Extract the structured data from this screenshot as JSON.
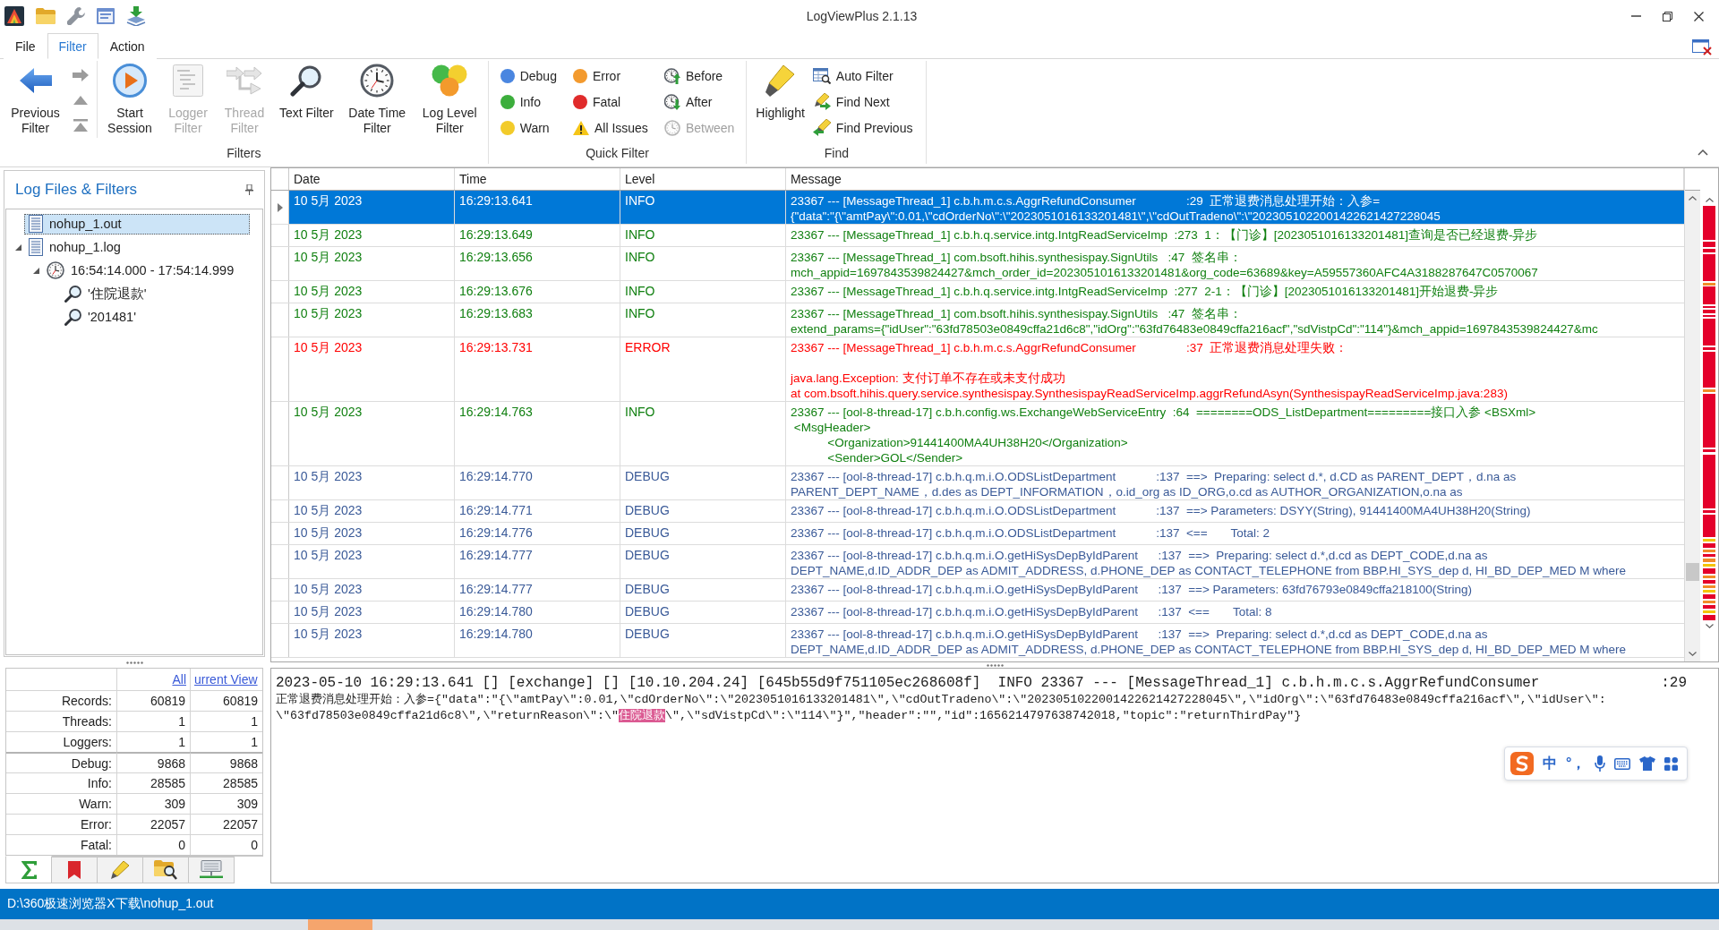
{
  "window": {
    "title": "LogViewPlus 2.1.13"
  },
  "menu_tabs": [
    {
      "label": "File",
      "selected": false
    },
    {
      "label": "Filter",
      "selected": true
    },
    {
      "label": "Action",
      "selected": false
    }
  ],
  "ribbon": {
    "filters_group": {
      "label": "Filters",
      "lead_button": {
        "label": "Previous Filter",
        "disabled": false
      },
      "nav_buttons": [
        {
          "kind": "next",
          "disabled": true
        },
        {
          "kind": "up",
          "disabled": true
        },
        {
          "kind": "top",
          "disabled": true
        }
      ],
      "buttons": [
        {
          "label": "Start Session",
          "kind": "start",
          "disabled": false
        },
        {
          "label": "Logger Filter",
          "kind": "logger",
          "disabled": true
        },
        {
          "label": "Thread Filter",
          "kind": "thread",
          "disabled": true
        },
        {
          "label": "Text Filter",
          "kind": "text",
          "disabled": false
        },
        {
          "label": "Date Time Filter",
          "kind": "datetime",
          "disabled": false
        },
        {
          "label": "Log Level Filter",
          "kind": "level",
          "disabled": false
        }
      ]
    },
    "quick_filter_group": {
      "label": "Quick Filter",
      "items": [
        {
          "label": "Debug",
          "kind": "level",
          "color": "#4a86e0",
          "disabled": false
        },
        {
          "label": "Info",
          "kind": "level",
          "color": "#3cae3c",
          "disabled": false
        },
        {
          "label": "Warn",
          "kind": "level",
          "color": "#f2cb2a",
          "disabled": false
        },
        {
          "label": "Error",
          "kind": "level",
          "color": "#f39a2e",
          "disabled": false
        },
        {
          "label": "Fatal",
          "kind": "level",
          "color": "#e02b2b",
          "disabled": false
        },
        {
          "label": "All Issues",
          "kind": "issues",
          "disabled": false
        },
        {
          "label": "Before",
          "kind": "before",
          "disabled": false
        },
        {
          "label": "After",
          "kind": "after",
          "disabled": false
        },
        {
          "label": "Between",
          "kind": "between",
          "disabled": true
        }
      ]
    },
    "find_group": {
      "label": "Find",
      "lead_button": {
        "label": "Highlight"
      },
      "items": [
        {
          "label": "Auto Filter",
          "kind": "autofilter"
        },
        {
          "label": "Find Next",
          "kind": "next"
        },
        {
          "label": "Find Previous",
          "kind": "previous"
        }
      ]
    }
  },
  "side_panel": {
    "title": "Log Files & Filters",
    "tree": [
      {
        "label": "nohup_1.out",
        "kind": "file",
        "selected": true
      },
      {
        "label": "nohup_1.log",
        "kind": "file",
        "selected": false,
        "expanded": true,
        "children": [
          {
            "label": "16:54:14.000 - 17:54:14.999",
            "kind": "time",
            "selected": false,
            "expanded": true,
            "children": [
              {
                "label": "'住院退款'",
                "kind": "text",
                "selected": false
              },
              {
                "label": "'201481'",
                "kind": "text",
                "selected": false
              }
            ]
          }
        ]
      }
    ],
    "stats": {
      "headers": [
        "All",
        "urrent View"
      ],
      "sections": [
        {
          "rows": [
            {
              "label": "Records:",
              "all": "60819",
              "current": "60819"
            },
            {
              "label": "Threads:",
              "all": "1",
              "current": "1"
            },
            {
              "label": "Loggers:",
              "all": "1",
              "current": "1"
            }
          ]
        },
        {
          "rows": [
            {
              "label": "Debug:",
              "all": "9868",
              "current": "9868"
            },
            {
              "label": "Info:",
              "all": "28585",
              "current": "28585"
            },
            {
              "label": "Warn:",
              "all": "309",
              "current": "309"
            },
            {
              "label": "Error:",
              "all": "22057",
              "current": "22057"
            },
            {
              "label": "Fatal:",
              "all": "0",
              "current": "0"
            }
          ]
        }
      ]
    },
    "tabs": [
      {
        "kind": "summary",
        "selected": true
      },
      {
        "kind": "bookmarks",
        "selected": false
      },
      {
        "kind": "highlights",
        "selected": false
      },
      {
        "kind": "files",
        "selected": false
      },
      {
        "kind": "remote",
        "selected": false
      }
    ]
  },
  "grid": {
    "columns": [
      "Date",
      "Time",
      "Level",
      "Message"
    ],
    "rows": [
      {
        "date": "10 5月 2023",
        "time": "16:29:13.641",
        "level": "INFO",
        "kind": "info",
        "selected": true,
        "message": "23367 --- [MessageThread_1] c.b.h.m.c.s.AggrRefundConsumer               :29  正常退费消息处理开始：入参=\n{\"data\":\"{\\\"amtPay\\\":0.01,\\\"cdOrderNo\\\":\\\"2023051016133201481\\\",\\\"cdOutTradeno\\\":\\\"2023051022001422621427228045"
      },
      {
        "date": "10 5月 2023",
        "time": "16:29:13.649",
        "level": "INFO",
        "kind": "info",
        "selected": false,
        "message": "23367 --- [MessageThread_1] c.b.h.q.service.intg.IntgReadServiceImp  :273  1：【门诊】[2023051016133201481]查询是否已经退费-异步"
      },
      {
        "date": "10 5月 2023",
        "time": "16:29:13.656",
        "level": "INFO",
        "kind": "info",
        "selected": false,
        "message": "23367 --- [MessageThread_1] com.bsoft.hihis.synthesispay.SignUtils   :47  签名串：\nmch_appid=1697843539824427&mch_order_id=2023051016133201481&org_code=63689&key=A59557360AFC4A3188287647C0570067"
      },
      {
        "date": "10 5月 2023",
        "time": "16:29:13.676",
        "level": "INFO",
        "kind": "info",
        "selected": false,
        "message": "23367 --- [MessageThread_1] c.b.h.q.service.intg.IntgReadServiceImp  :277  2-1：【门诊】[2023051016133201481]开始退费-异步"
      },
      {
        "date": "10 5月 2023",
        "time": "16:29:13.683",
        "level": "INFO",
        "kind": "info",
        "selected": false,
        "message": "23367 --- [MessageThread_1] com.bsoft.hihis.synthesispay.SignUtils   :47  签名串：\nextend_params={\"idUser\":\"63fd78503e0849cffa21d6c8\",\"idOrg\":\"63fd76483e0849cffa216acf\",\"sdVistpCd\":\"114\"}&mch_appid=1697843539824427&mc"
      },
      {
        "date": "10 5月 2023",
        "time": "16:29:13.731",
        "level": "ERROR",
        "kind": "error",
        "selected": false,
        "message": "23367 --- [MessageThread_1] c.b.h.m.c.s.AggrRefundConsumer               :37  正常退费消息处理失败：\n\njava.lang.Exception: 支付订单不存在或未支付成功\nat com.bsoft.hihis.query.service.synthesispay.SynthesispayReadServiceImp.aggrRefundAsyn(SynthesispayReadServiceImp.java:283)"
      },
      {
        "date": "10 5月 2023",
        "time": "16:29:14.763",
        "level": "INFO",
        "kind": "info",
        "selected": false,
        "message": "23367 --- [ool-8-thread-17] c.b.h.config.ws.ExchangeWebServiceEntry  :64  ========ODS_ListDepartment=========接口入参 <BSXml>\n <MsgHeader>\n\t<Organization>91441400MA4UH38H20</Organization>\n\t<Sender>GOL</Sender>"
      },
      {
        "date": "10 5月 2023",
        "time": "16:29:14.770",
        "level": "DEBUG",
        "kind": "debug",
        "selected": false,
        "message": "23367 --- [ool-8-thread-17] c.b.h.q.m.i.O.ODSListDepartment            :137  ==>  Preparing: select d.*, d.CD as PARENT_DEPT，d.na as\nPARENT_DEPT_NAME，d.des as DEPT_INFORMATION，o.id_org as ID_ORG,o.cd as AUTHOR_ORGANIZATION,o.na as"
      },
      {
        "date": "10 5月 2023",
        "time": "16:29:14.771",
        "level": "DEBUG",
        "kind": "debug",
        "selected": false,
        "message": "23367 --- [ool-8-thread-17] c.b.h.q.m.i.O.ODSListDepartment            :137  ==> Parameters: DSYY(String), 91441400MA4UH38H20(String)"
      },
      {
        "date": "10 5月 2023",
        "time": "16:29:14.776",
        "level": "DEBUG",
        "kind": "debug",
        "selected": false,
        "message": "23367 --- [ool-8-thread-17] c.b.h.q.m.i.O.ODSListDepartment            :137  <==       Total: 2"
      },
      {
        "date": "10 5月 2023",
        "time": "16:29:14.777",
        "level": "DEBUG",
        "kind": "debug",
        "selected": false,
        "message": "23367 --- [ool-8-thread-17] c.b.h.q.m.i.O.getHiSysDepByIdParent      :137  ==>  Preparing: select d.*,d.cd as DEPT_CODE,d.na as\nDEPT_NAME,d.ID_ADDR_DEP as ADMIT_ADDRESS, d.PHONE_DEP as CONTACT_TELEPHONE from BBP.HI_SYS_dep d, HI_BD_DEP_MED M where"
      },
      {
        "date": "10 5月 2023",
        "time": "16:29:14.777",
        "level": "DEBUG",
        "kind": "debug",
        "selected": false,
        "message": "23367 --- [ool-8-thread-17] c.b.h.q.m.i.O.getHiSysDepByIdParent      :137  ==> Parameters: 63fd76793e0849cffa218100(String)"
      },
      {
        "date": "10 5月 2023",
        "time": "16:29:14.780",
        "level": "DEBUG",
        "kind": "debug",
        "selected": false,
        "message": "23367 --- [ool-8-thread-17] c.b.h.q.m.i.O.getHiSysDepByIdParent      :137  <==       Total: 8"
      },
      {
        "date": "10 5月 2023",
        "time": "16:29:14.780",
        "level": "DEBUG",
        "kind": "debug",
        "selected": false,
        "message": "23367 --- [ool-8-thread-17] c.b.h.q.m.i.O.getHiSysDepByIdParent      :137  ==>  Preparing: select d.*,d.cd as DEPT_CODE,d.na as\nDEPT_NAME,d.ID_ADDR_DEP as ADMIT_ADDRESS, d.PHONE_DEP as CONTACT_TELEPHONE from BBP.HI_SYS_dep d, HI_BD_DEP_MED M where"
      }
    ]
  },
  "detail": {
    "header": "2023-05-10 16:29:13.641 [] [exchange] [] [10.10.204.24] [645b55d9f751105ec268608f]  INFO 23367 --- [MessageThread_1] c.b.h.m.c.s.AggrRefundConsumer",
    "header_end": ":29",
    "lines": [
      [
        {
          "text": "正常退费消息处理开始：入参={\"data\":\"{\\\"amtPay\\\":0.01,\\\"cdOrderNo\\\":\\\"2023051016133201481\\\",\\\"cdOutTradeno\\\":\\\"2023051022001422621427228045\\\",\\\"idOrg\\\":\\\"63fd76483e0849cffa216acf\\\",\\\"idUser\\\":",
          "highlighted": false
        }
      ],
      [
        {
          "text": "\\\"63fd78503e0849cffa21d6c8\\\",\\\"returnReason\\\":\\\"",
          "highlighted": false
        },
        {
          "text": "住院退款",
          "highlighted": true
        },
        {
          "text": "\\\",\\\"sdVistpCd\\\":\\\"114\\\"}\",\"header\":\"\",\"id\":1656214797638742018,\"topic\":\"returnThirdPay\"}",
          "highlighted": false
        }
      ]
    ]
  },
  "ime_toolbar": {
    "mode": "中",
    "punctuation": "°，"
  },
  "status_bar": {
    "path": "D:\\360极速浏览器X下载\\nohup_1.out"
  }
}
